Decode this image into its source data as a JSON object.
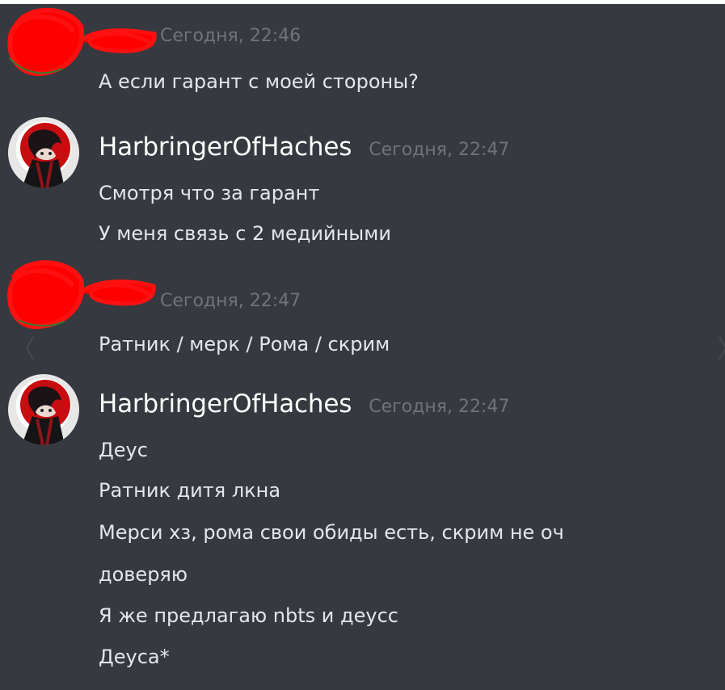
{
  "messages": [
    {
      "author": "",
      "timestamp": "Сегодня, 22:46",
      "lines": [
        "А если гарант с моей стороны?"
      ]
    },
    {
      "author": "HarbringerOfHaches",
      "timestamp": "Сегодня, 22:47",
      "lines": [
        "Смотря что за гарант",
        "У меня связь с 2 медийными"
      ]
    },
    {
      "author": "",
      "timestamp": "Сегодня, 22:47",
      "lines": [
        "Ратник / мерк / Рома / скрим"
      ]
    },
    {
      "author": "HarbringerOfHaches",
      "timestamp": "Сегодня, 22:47",
      "lines": [
        "Деус",
        "Ратник дитя лкна",
        "Мерси хз, рома свои обиды есть, скрим не оч",
        "доверяю",
        "Я же предлагаю nbts и деусс",
        "Деуса*"
      ]
    }
  ],
  "icons": {
    "redaction": "red-scribble",
    "avatar": "anime-avatar",
    "previous": "chevron-left-icon",
    "next": "chevron-right-icon"
  },
  "colors": {
    "background": "#36393f",
    "message_text": "#e4e6eb",
    "timestamp": "#6f737b",
    "redaction": "#ff0000"
  }
}
